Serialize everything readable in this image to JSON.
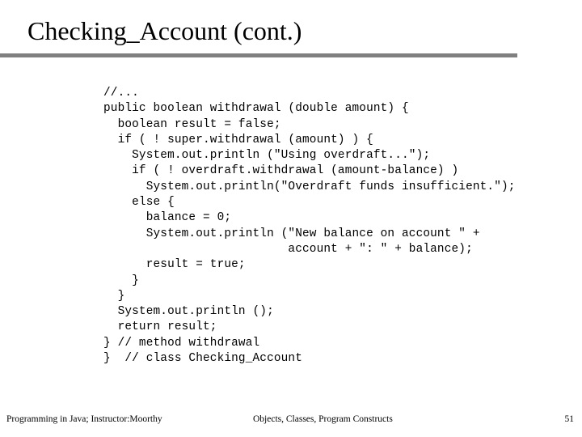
{
  "slide": {
    "title": "Checking_Account (cont.)",
    "rule_color": "#808080",
    "background_color": "#ffffff",
    "text_color": "#000000"
  },
  "code": {
    "lines": [
      "//...",
      "public boolean withdrawal (double amount) {",
      "  boolean result = false;",
      "  if ( ! super.withdrawal (amount) ) {",
      "    System.out.println (\"Using overdraft...\");",
      "    if ( ! overdraft.withdrawal (amount-balance) )",
      "      System.out.println(\"Overdraft funds insufficient.\");",
      "    else {",
      "      balance = 0;",
      "      System.out.println (\"New balance on account \" +",
      "                          account + \": \" + balance);",
      "      result = true;",
      "    }",
      "  }",
      "  System.out.println ();",
      "  return result;",
      "} // method withdrawal",
      "}  // class Checking_Account"
    ]
  },
  "footer": {
    "left": "Programming in Java; Instructor:Moorthy",
    "center": "Objects, Classes, Program Constructs",
    "page": "51"
  }
}
